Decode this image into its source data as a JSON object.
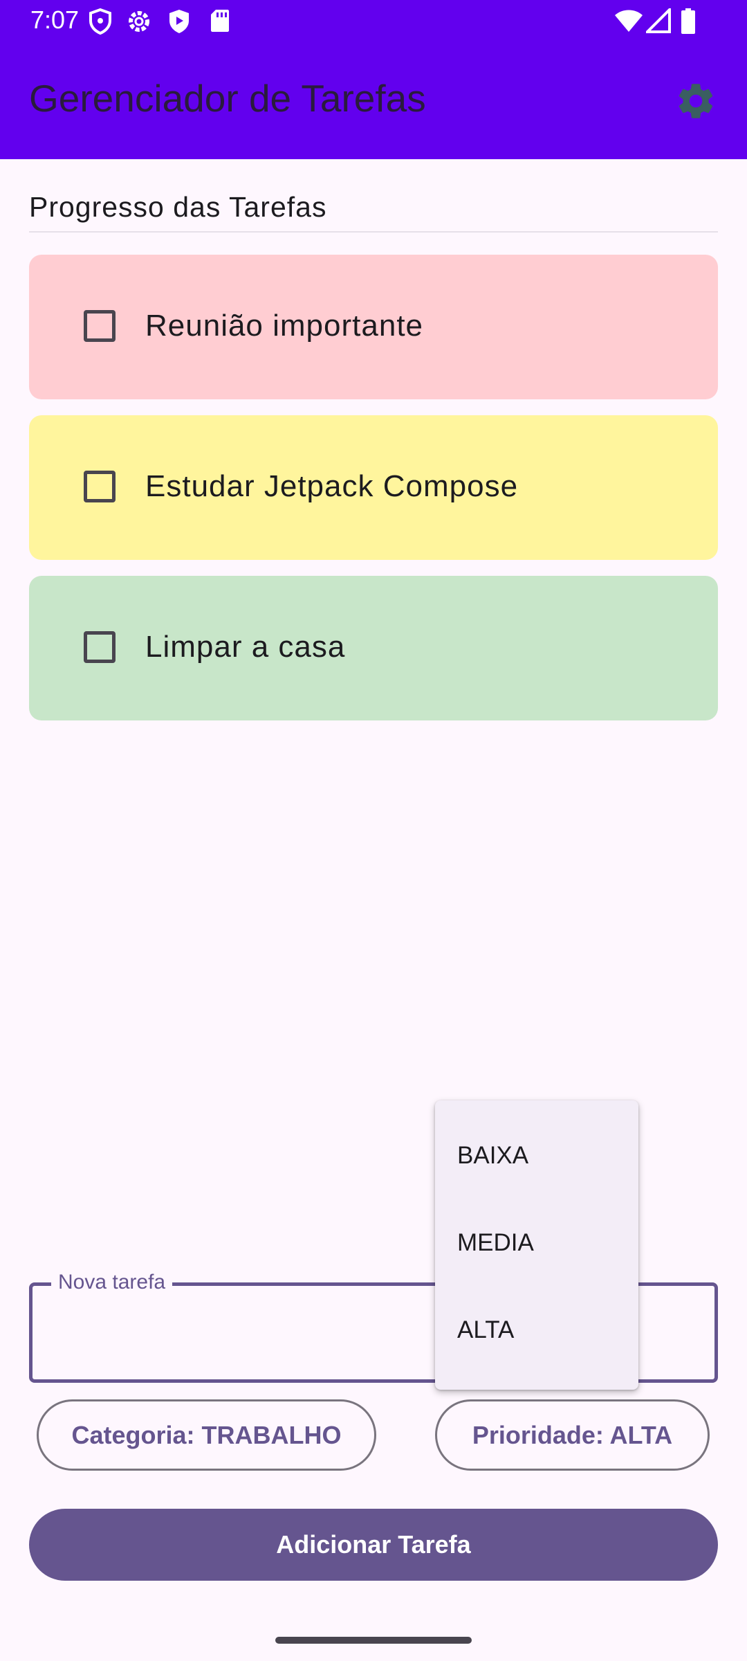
{
  "status_bar": {
    "time": "7:07"
  },
  "app_bar": {
    "title": "Gerenciador de Tarefas",
    "settings_icon": "gear-icon"
  },
  "section": {
    "title": "Progresso das Tarefas"
  },
  "tasks": [
    {
      "label": "Reunião importante",
      "checked": false,
      "color": "#FFCDD2"
    },
    {
      "label": "Estudar Jetpack Compose",
      "checked": false,
      "color": "#FFF59D"
    },
    {
      "label": "Limpar a casa",
      "checked": false,
      "color": "#C8E6C9"
    }
  ],
  "input": {
    "label": "Nova tarefa",
    "value": ""
  },
  "category_button": {
    "label": "Categoria: TRABALHO"
  },
  "priority_button": {
    "label": "Prioridade: ALTA"
  },
  "priority_menu": {
    "options": [
      "BAIXA",
      "MEDIA",
      "ALTA"
    ]
  },
  "add_button": {
    "label": "Adicionar Tarefa"
  },
  "colors": {
    "app_bar": "#6200EE",
    "accent": "#65558F",
    "background": "#FEF7FE"
  }
}
